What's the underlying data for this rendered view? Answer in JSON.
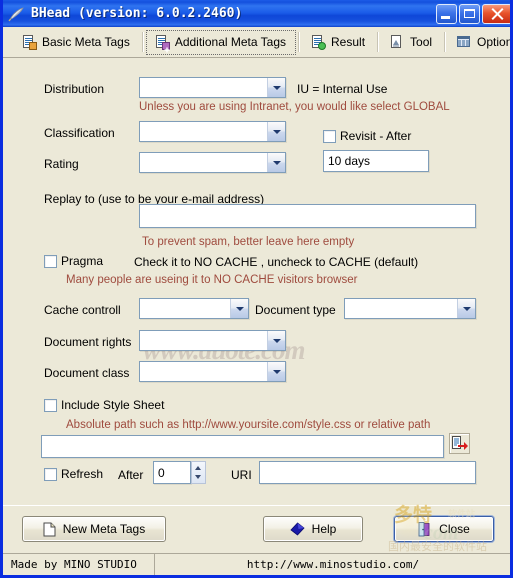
{
  "window": {
    "title": "BHead (version: 6.0.2.2460)",
    "icon": "feather-icon",
    "controls": {
      "minimize": "minimize-button",
      "maximize": "maximize-button",
      "close": "close-button"
    }
  },
  "tabs": [
    {
      "label": "Basic Meta Tags",
      "icon": "document-lock-icon",
      "selected": false
    },
    {
      "label": "Additional Meta Tags",
      "icon": "document-plus-icon",
      "selected": true
    },
    {
      "label": "Result",
      "icon": "document-check-icon",
      "selected": false
    },
    {
      "label": "Tool",
      "icon": "document-tool-icon",
      "selected": false
    },
    {
      "label": "Options",
      "icon": "options-grid-icon",
      "selected": false
    }
  ],
  "form": {
    "distribution": {
      "label": "Distribution",
      "value": "",
      "side_note": "IU = Internal Use",
      "hint": "Unless you are using Intranet, you would like select GLOBAL"
    },
    "classification": {
      "label": "Classification",
      "value": ""
    },
    "rating": {
      "label": "Rating",
      "value": ""
    },
    "revisit": {
      "label": "Revisit - After",
      "checked": false,
      "value": "10 days"
    },
    "replay_to": {
      "label": "Replay to (use to be your e-mail address)",
      "value": "",
      "hint": "To prevent spam, better leave here empty"
    },
    "pragma": {
      "label": "Pragma",
      "checked": false,
      "description": "Check it to NO CACHE , uncheck to CACHE (default)",
      "hint": "Many people are useing it to NO CACHE visitors browser"
    },
    "cache_control": {
      "label": "Cache controll",
      "value": ""
    },
    "document_type": {
      "label": "Document type",
      "value": ""
    },
    "document_rights": {
      "label": "Document rights",
      "value": ""
    },
    "document_class": {
      "label": "Document class",
      "value": ""
    },
    "style_sheet": {
      "label": "Include Style Sheet",
      "checked": false,
      "hint": "Absolute path such as http://www.yoursite.com/style.css or relative path",
      "value": "",
      "browse_icon": "document-export-icon"
    },
    "refresh": {
      "label": "Refresh",
      "checked": false,
      "after_label": "After",
      "after_value": "0",
      "uri_label": "URI",
      "uri_value": ""
    }
  },
  "buttons": {
    "new_meta_tags": {
      "label": "New Meta Tags",
      "icon": "new-document-icon"
    },
    "help": {
      "label": "Help",
      "icon": "help-diamond-icon"
    },
    "close": {
      "label": "Close",
      "icon": "exit-door-icon"
    }
  },
  "statusbar": {
    "left": "Made by MINO STUDIO",
    "right": "http://www.minostudio.com/"
  },
  "watermarks": {
    "url": "www.duote.com",
    "logo_cn": "多特",
    "logo_cn_small": "软件站",
    "logo_sub": "国内最安全的软件站",
    "logo_com": "com"
  },
  "colors": {
    "titlebar": "#1a5be8",
    "face": "#ece9d8",
    "hint": "#9f4b3e",
    "field_border": "#7f9db9"
  }
}
